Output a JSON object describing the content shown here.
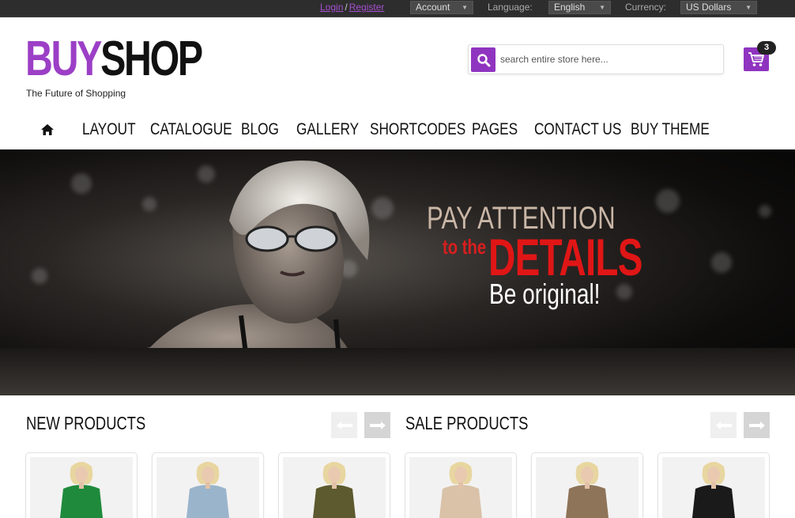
{
  "topbar": {
    "login": "Login",
    "separator": "/",
    "register": "Register",
    "account": "Account",
    "language_label": "Language:",
    "language_value": "English",
    "currency_label": "Currency:",
    "currency_value": "US Dollars"
  },
  "header": {
    "logo_part1": "BUY",
    "logo_part2": "SHOP",
    "tagline": "The Future of Shopping",
    "search_placeholder": "search entire store here...",
    "cart_count": "3"
  },
  "nav": {
    "home_icon": "home-icon",
    "items": [
      "LAYOUT",
      "CATALOGUE",
      "BLOG",
      "GALLERY",
      "SHORTCODES",
      "PAGES",
      "CONTACT US",
      "BUY THEME"
    ]
  },
  "banner": {
    "line1": "PAY ATTENTION",
    "line2": "to the",
    "line3": "DETAILS",
    "line4": "Be original!"
  },
  "sections": {
    "new_title": "NEW PRODUCTS",
    "sale_title": "SALE PRODUCTS"
  },
  "colors": {
    "accent": "#8f34c0",
    "banner_red": "#e01616"
  },
  "products": {
    "new": [
      {
        "coat_color": "#1f8a3c"
      },
      {
        "coat_color": "#9ab4cc"
      },
      {
        "coat_color": "#5c5a2e"
      }
    ],
    "sale": [
      {
        "coat_color": "#d9c2a8"
      },
      {
        "coat_color": "#8e7458"
      },
      {
        "coat_color": "#1a1a1a"
      }
    ]
  }
}
